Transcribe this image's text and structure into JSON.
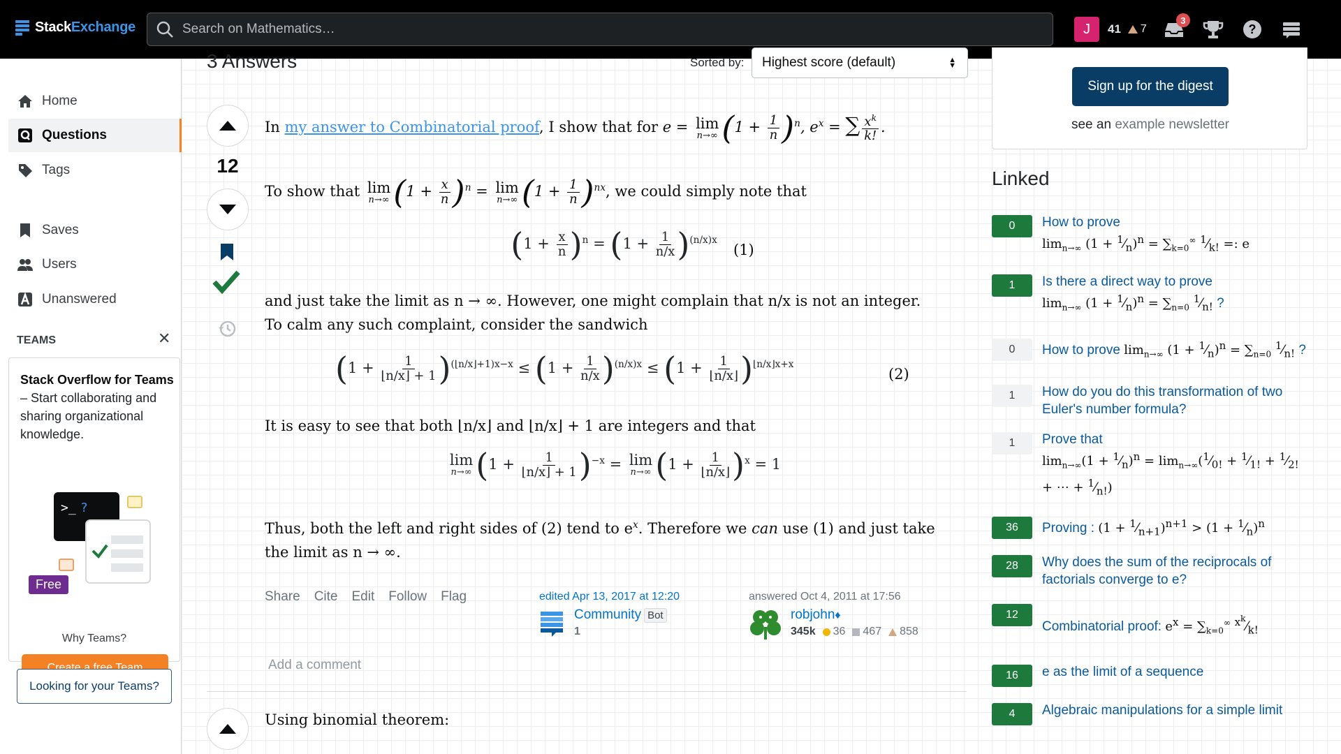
{
  "topbar": {
    "logo_stack": "Stack",
    "logo_exchange": "Exchange",
    "search_placeholder": "Search on Mathematics…",
    "avatar_letter": "J",
    "reputation": "41",
    "bronze_badges": "7",
    "inbox_count": "3"
  },
  "leftnav": {
    "items": [
      {
        "label": "Home"
      },
      {
        "label": "Questions"
      },
      {
        "label": "Tags"
      },
      {
        "label": "Saves"
      },
      {
        "label": "Users"
      },
      {
        "label": "Unanswered"
      }
    ],
    "teams_header": "TEAMS",
    "teams_title": "Stack Overflow for Teams",
    "teams_desc": " – Start collaborating and sharing organizational knowledge.",
    "free_tag": "Free",
    "create_team": "Create a free Team",
    "why_teams": "Why Teams?",
    "looking": "Looking for your Teams?"
  },
  "main": {
    "answers_count": "3 Answers",
    "sorted_label": "Sorted by:",
    "sort_value": "Highest score (default)",
    "answer1": {
      "score": "12",
      "p1_pre": "In ",
      "p1_link": "my answer to Combinatorial proof",
      "p1_post": ", I show that for ",
      "p2_pre": "To show that ",
      "p2_post": ", we could simply note that",
      "p3": "and just take the limit as n → ∞. However, one might complain that n/x is not an integer. To calm any such complaint, consider the sandwich",
      "p4": "It is easy to see that both ⌊n/x⌋ and ⌊n/x⌋ + 1 are integers and that",
      "p5_a": "Thus, both the left and right sides of (2) tend to e",
      "p5_b": ". Therefore we ",
      "p5_can": "can",
      "p5_c": " use (1) and just take the limit as n → ∞.",
      "eq1_label": "(1)",
      "eq2_label": "(2)",
      "actions": [
        "Share",
        "Cite",
        "Edit",
        "Follow",
        "Flag"
      ],
      "edited": "edited Apr 13, 2017 at 12:20",
      "editor_name": "Community",
      "editor_tag": "Bot",
      "editor_rep": "1",
      "answered": "answered Oct 4, 2011 at 17:56",
      "author_name": "robjohn",
      "author_mod": "♦",
      "author_rep": "345k",
      "gold": "36",
      "silver": "467",
      "bronze": "858",
      "add_comment": "Add a comment"
    },
    "answer2": {
      "text": "Using binomial theorem:"
    }
  },
  "right": {
    "digest_button": "Sign up for the digest",
    "see_an": "see an ",
    "example_newsletter": "example newsletter",
    "linked_header": "Linked",
    "linked": [
      {
        "score": "0",
        "answered": true,
        "title": "How to prove"
      },
      {
        "score": "1",
        "answered": true,
        "title": "Is there a direct way to prove"
      },
      {
        "score": "0",
        "answered": false,
        "title": "How to prove"
      },
      {
        "score": "1",
        "answered": false,
        "title": "How do you do this transformation of two Euler's number formula?"
      },
      {
        "score": "1",
        "answered": false,
        "title": "Prove that"
      },
      {
        "score": "36",
        "answered": true,
        "title": "Proving :"
      },
      {
        "score": "28",
        "answered": true,
        "title": "Why does the sum of the reciprocals of factorials converge to e?"
      },
      {
        "score": "12",
        "answered": true,
        "title": "Combinatorial proof:"
      },
      {
        "score": "16",
        "answered": true,
        "title": "e as the limit of a sequence"
      },
      {
        "score": "4",
        "answered": true,
        "title": "Algebraic manipulations for a simple limit"
      }
    ]
  },
  "colors": {
    "accent_orange": "#f48225",
    "link_blue": "#0074cc",
    "answered_green": "#1e7a3c",
    "digest_navy": "#0a3d66"
  }
}
